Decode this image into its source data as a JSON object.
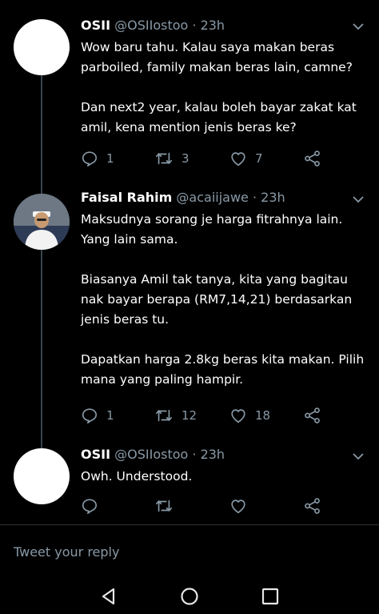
{
  "tweets": [
    {
      "name": "OSII",
      "handle": "@OSIIostoo",
      "time": "· 23h",
      "avatar": "blank-avatar",
      "paragraphs": [
        "Wow baru tahu. Kalau saya makan beras parboiled, family makan beras lain, camne?",
        "Dan next2 year, kalau boleh bayar zakat kat amil, kena mention jenis beras ke?"
      ],
      "replies": "1",
      "retweets": "3",
      "likes": "7"
    },
    {
      "name": "Faisal Rahim",
      "handle": "@acaiijawe",
      "time": "· 23h",
      "avatar": "profile-photo",
      "paragraphs": [
        "Maksudnya sorang je harga fitrahnya lain. Yang lain sama.",
        "Biasanya Amil tak tanya, kita yang bagitau nak bayar berapa (RM7,14,21) berdasarkan jenis beras tu.",
        "Dapatkan harga 2.8kg beras kita makan. Pilih mana yang paling hampir."
      ],
      "replies": "1",
      "retweets": "12",
      "likes": "18"
    },
    {
      "name": "OSII",
      "handle": "@OSIIostoo",
      "time": "· 23h",
      "avatar": "blank-avatar",
      "paragraphs": [
        "Owh. Understood."
      ],
      "replies": "",
      "retweets": "",
      "likes": ""
    }
  ],
  "reply_box": {
    "placeholder": "Tweet your reply"
  },
  "icons": {
    "reply": "reply-icon",
    "retweet": "retweet-icon",
    "like": "heart-icon",
    "share": "share-icon",
    "caret": "chevron-down-icon",
    "nav_back": "back-icon",
    "nav_home": "home-icon",
    "nav_recents": "recents-icon"
  },
  "colors": {
    "background": "#000000",
    "text": "#ffffff",
    "secondary": "#8899a6",
    "thread_line": "#38444d"
  }
}
